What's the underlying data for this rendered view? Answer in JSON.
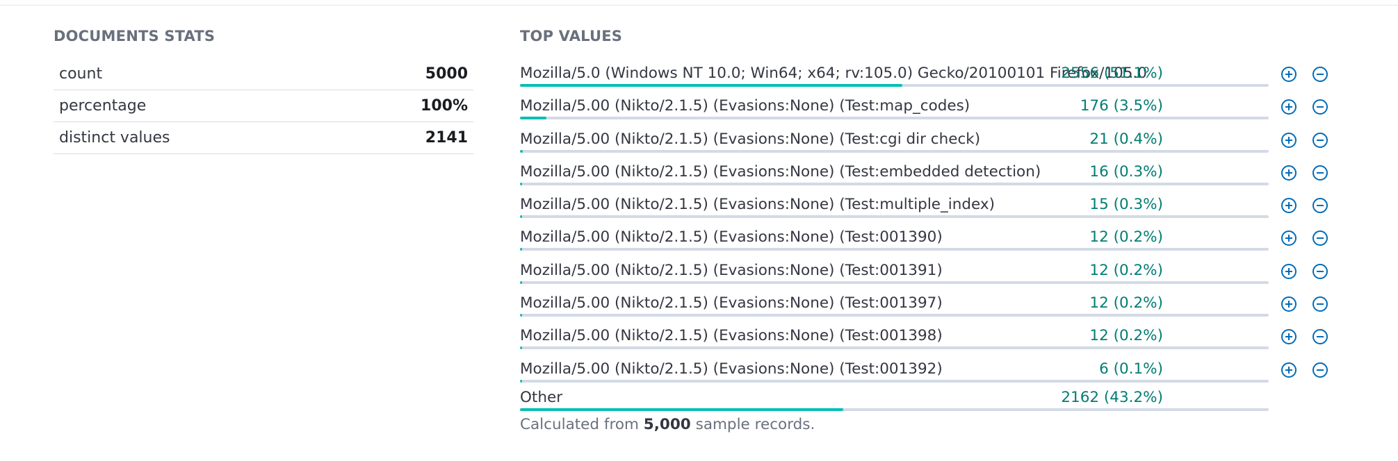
{
  "stats": {
    "title": "DOCUMENTS STATS",
    "rows": [
      {
        "label": "count",
        "value": "5000"
      },
      {
        "label": "percentage",
        "value": "100%"
      },
      {
        "label": "distinct values",
        "value": "2141"
      }
    ]
  },
  "top_values": {
    "title": "TOP VALUES",
    "rows": [
      {
        "label": "Mozilla/5.0 (Windows NT 10.0; Win64; x64; rv:105.0) Gecko/20100101 Firefox/105.0",
        "value": "2556 (51.1%)",
        "fraction": 0.511
      },
      {
        "label": "Mozilla/5.00 (Nikto/2.1.5) (Evasions:None) (Test:map_codes)",
        "value": "176 (3.5%)",
        "fraction": 0.035
      },
      {
        "label": "Mozilla/5.00 (Nikto/2.1.5) (Evasions:None) (Test:cgi dir check)",
        "value": "21 (0.4%)",
        "fraction": 0.004
      },
      {
        "label": "Mozilla/5.00 (Nikto/2.1.5) (Evasions:None) (Test:embedded detection)",
        "value": "16 (0.3%)",
        "fraction": 0.003
      },
      {
        "label": "Mozilla/5.00 (Nikto/2.1.5) (Evasions:None) (Test:multiple_index)",
        "value": "15 (0.3%)",
        "fraction": 0.003
      },
      {
        "label": "Mozilla/5.00 (Nikto/2.1.5) (Evasions:None) (Test:001390)",
        "value": "12 (0.2%)",
        "fraction": 0.002
      },
      {
        "label": "Mozilla/5.00 (Nikto/2.1.5) (Evasions:None) (Test:001391)",
        "value": "12 (0.2%)",
        "fraction": 0.002
      },
      {
        "label": "Mozilla/5.00 (Nikto/2.1.5) (Evasions:None) (Test:001397)",
        "value": "12 (0.2%)",
        "fraction": 0.002
      },
      {
        "label": "Mozilla/5.00 (Nikto/2.1.5) (Evasions:None) (Test:001398)",
        "value": "12 (0.2%)",
        "fraction": 0.002
      },
      {
        "label": "Mozilla/5.00 (Nikto/2.1.5) (Evasions:None) (Test:001392)",
        "value": "6 (0.1%)",
        "fraction": 0.001
      }
    ],
    "other": {
      "label": "Other",
      "value": "2162 (43.2%)",
      "fraction": 0.432
    },
    "footnote": {
      "prefix": "Calculated from ",
      "count": "5,000",
      "suffix": " sample records."
    }
  },
  "icons": {
    "plus": "plus-in-circle-icon",
    "minus": "minus-in-circle-icon"
  },
  "colors": {
    "value_text": "#017d73",
    "bar_fill": "#00bfb3",
    "bar_track": "#d3dae6",
    "icon": "#006bb8"
  }
}
